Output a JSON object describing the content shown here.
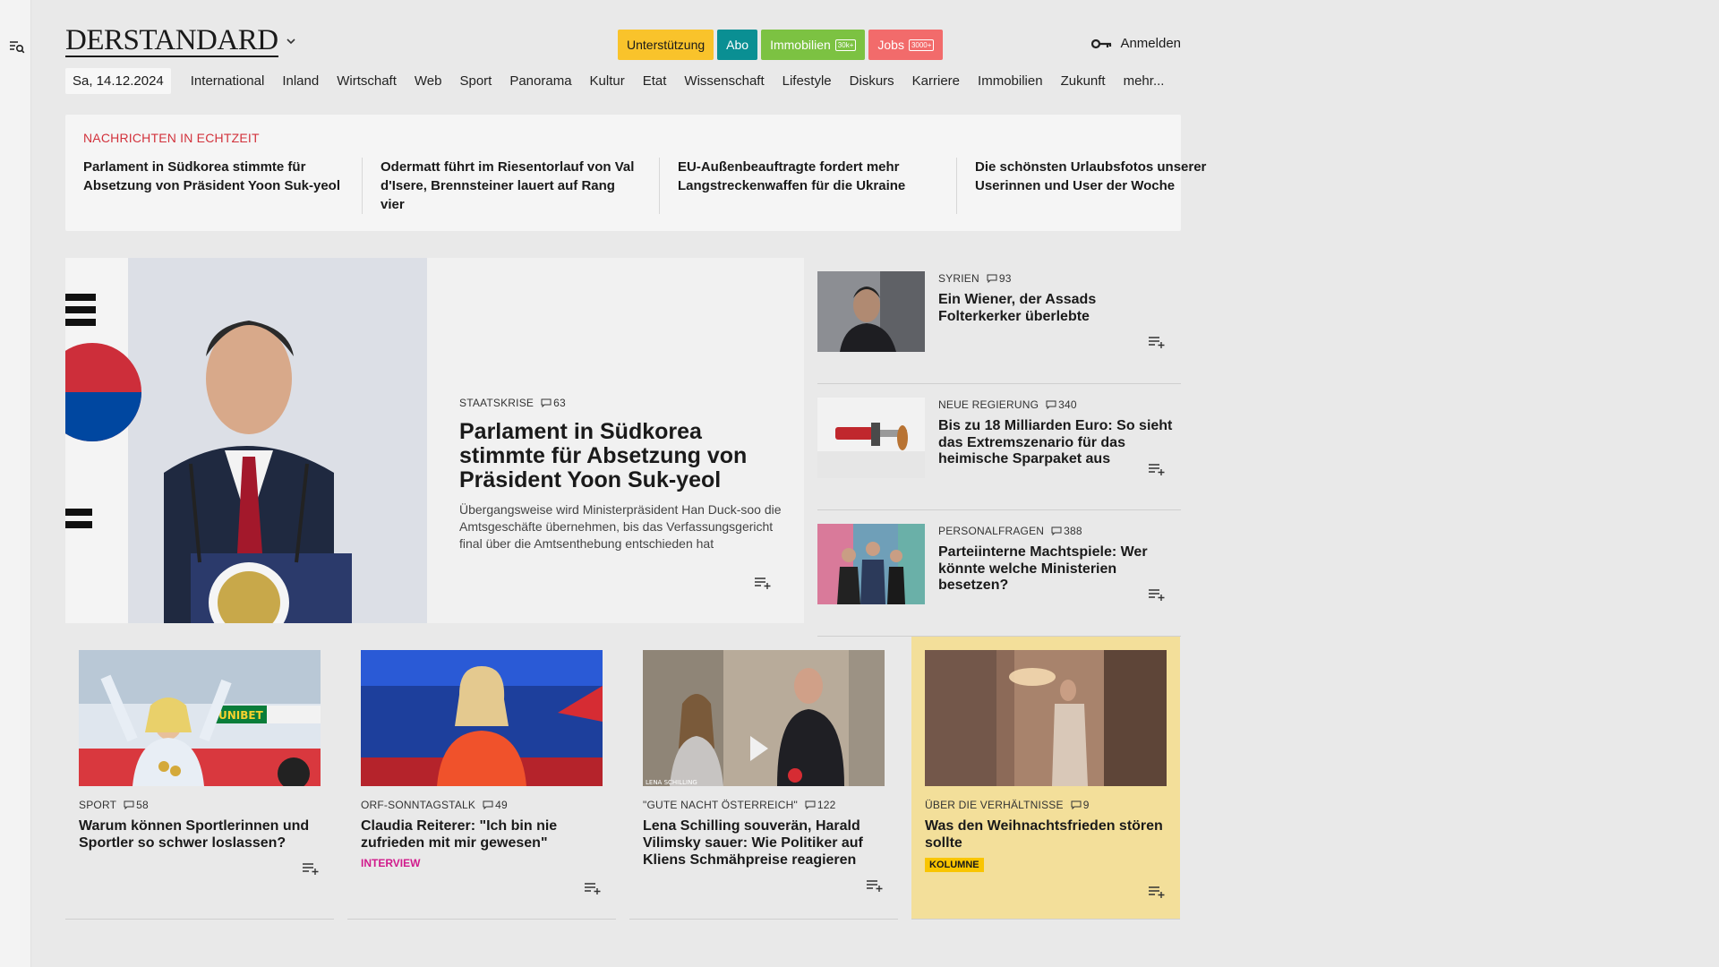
{
  "header": {
    "logo": "DERSTANDARD",
    "pills": [
      {
        "label": "Unterstützung",
        "bg": "#f9c32b",
        "fg": "#1a1a1a",
        "tag": ""
      },
      {
        "label": "Abo",
        "bg": "#0a8f93",
        "fg": "#ffffff",
        "tag": ""
      },
      {
        "label": "Immobilien",
        "bg": "#7cc242",
        "fg": "#ffffff",
        "tag": "30k+"
      },
      {
        "label": "Jobs",
        "bg": "#f26b6b",
        "fg": "#ffffff",
        "tag": "3000+"
      }
    ],
    "login_label": "Anmelden"
  },
  "nav": {
    "date": "Sa, 14.12.2024",
    "items": [
      "International",
      "Inland",
      "Wirtschaft",
      "Web",
      "Sport",
      "Panorama",
      "Kultur",
      "Etat",
      "Wissenschaft",
      "Lifestyle",
      "Diskurs",
      "Karriere",
      "Immobilien",
      "Zukunft",
      "mehr..."
    ]
  },
  "ticker": {
    "label": "NACHRICHTEN IN ECHTZEIT",
    "items": [
      "Parlament in Südkorea stimmte für Absetzung von Präsident Yoon Suk-yeol",
      "Odermatt führt im Riesentorlauf von Val d'Isere, Brennsteiner lauert auf Rang vier",
      "EU-Außenbeauftragte fordert mehr Langstreckenwaffen für die Ukraine",
      "Die schönsten Urlaubsfotos unserer Userinnen und User der Woche"
    ]
  },
  "hero": {
    "kicker": "STAATSKRISE",
    "comments": "63",
    "title": "Parlament in Südkorea stimmte für Absetzung von Präsident Yoon Suk-yeol",
    "teaser": "Übergangsweise wird Ministerpräsident Han Duck-soo die Amtsgeschäfte übernehmen, bis das Verfassungsgericht final über die Amtsenthebung entschieden hat"
  },
  "side": [
    {
      "kicker": "SYRIEN",
      "comments": "93",
      "title": "Ein Wiener, der Assads Folterkerker überlebte"
    },
    {
      "kicker": "NEUE REGIERUNG",
      "comments": "340",
      "title": "Bis zu 18 Milliarden Euro: So sieht das Extremszenario für das heimische Sparpaket aus"
    },
    {
      "kicker": "PERSONALFRAGEN",
      "comments": "388",
      "title": "Parteiinterne Machtspiele: Wer könnte welche Ministerien besetzen?"
    }
  ],
  "cards": [
    {
      "kicker": "SPORT",
      "comments": "58",
      "title": "Warum können Sportlerinnen und Sportler so schwer loslassen?",
      "tag": ""
    },
    {
      "kicker": "ORF-SONNTAGSTALK",
      "comments": "49",
      "title": "Claudia Reiterer: \"Ich bin nie zufrieden mit mir gewesen\"",
      "tag": "INTERVIEW"
    },
    {
      "kicker": "\"GUTE NACHT ÖSTERREICH\"",
      "comments": "122",
      "title": "Lena Schilling souverän, Harald Vilimsky sauer: Wie Politiker auf Kliens Schmähpreise reagieren",
      "tag": ""
    },
    {
      "kicker": "ÜBER DIE VERHÄLTNISSE",
      "comments": "9",
      "title": "Was den Weihnachtsfrieden stören sollte",
      "tag": "KOLUMNE"
    }
  ],
  "card_image_caption": "LENA SCHILLING",
  "image_banner": "UNIBET"
}
